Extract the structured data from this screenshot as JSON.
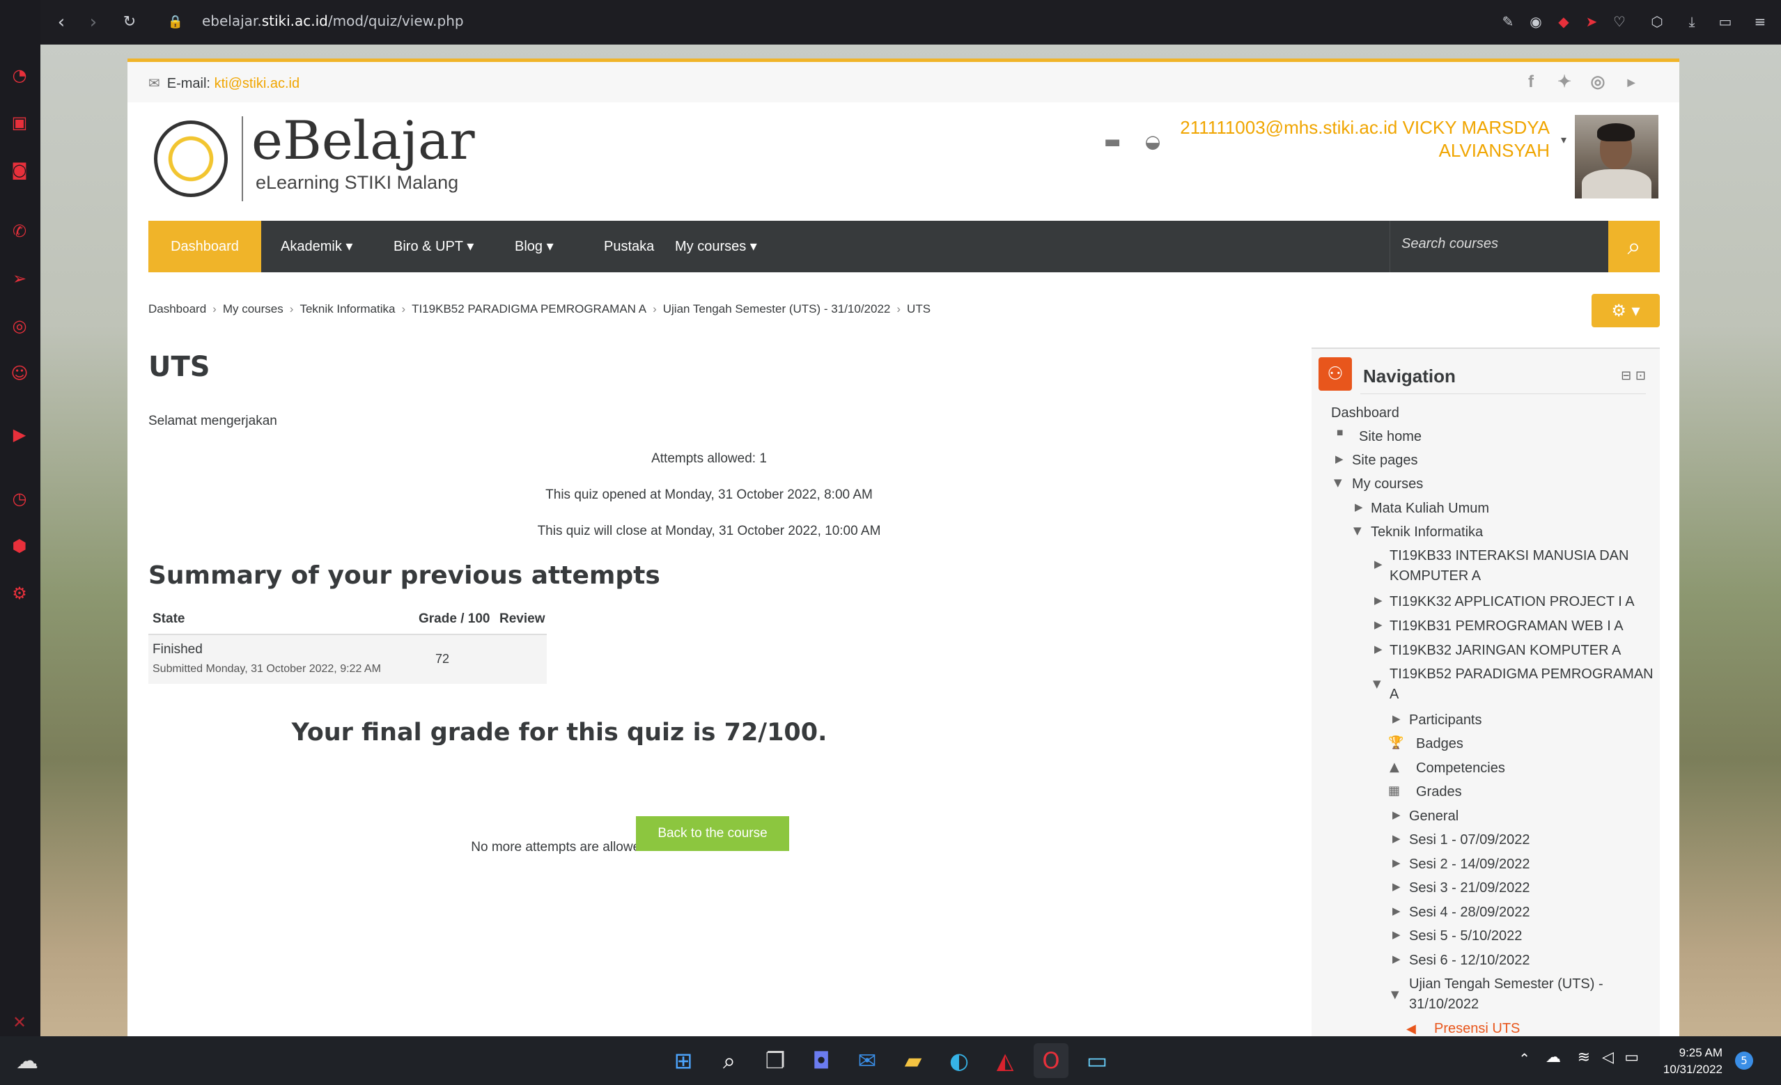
{
  "browser": {
    "url_prefix": "ebelajar.",
    "url_domain": "stiki.ac.id",
    "url_path": "/mod/quiz/view.php"
  },
  "topbar": {
    "email_label": "E-mail:",
    "email_value": "kti@stiki.ac.id"
  },
  "header": {
    "logo_title": "eBelajar",
    "logo_subtitle": "eLearning STIKI Malang",
    "user_name": "211111003@mhs.stiki.ac.id VICKY MARSDYA ALVIANSYAH"
  },
  "mainnav": {
    "items": [
      {
        "label": "Dashboard"
      },
      {
        "label": "Akademik ▾"
      },
      {
        "label": "Biro & UPT ▾"
      },
      {
        "label": "Blog ▾"
      },
      {
        "label": "Pustaka"
      },
      {
        "label": "My courses ▾"
      }
    ],
    "search_placeholder": "Search courses"
  },
  "breadcrumb": [
    "Dashboard",
    "My courses",
    "Teknik Informatika",
    "TI19KB52 PARADIGMA PEMROGRAMAN A",
    "Ujian Tengah Semester (UTS) - 31/10/2022",
    "UTS"
  ],
  "main": {
    "title": "UTS",
    "intro": "Selamat mengerjakan",
    "attempts_allowed": "Attempts allowed: 1",
    "opened": "This quiz opened at Monday, 31 October 2022, 8:00 AM",
    "closes": "This quiz will close at Monday, 31 October 2022, 10:00 AM",
    "summary_title": "Summary of your previous attempts",
    "table": {
      "headers": [
        "State",
        "Grade / 100",
        "Review"
      ],
      "row_state": "Finished",
      "row_submitted": "Submitted Monday, 31 October 2022, 9:22 AM",
      "row_grade": "72"
    },
    "final_grade": "Your final grade for this quiz is 72/100.",
    "no_more": "No more attempts are allowed",
    "back_button": "Back to the course"
  },
  "navigation": {
    "title": "Navigation",
    "dashboard": "Dashboard",
    "site_home": "Site home",
    "site_pages": "Site pages",
    "my_courses": "My courses",
    "mku": "Mata Kuliah Umum",
    "ti": "Teknik Informatika",
    "c1a": "TI19KB33 INTERAKSI MANUSIA DAN",
    "c1b": "KOMPUTER A",
    "c2": "TI19KK32 APPLICATION PROJECT I A",
    "c3": "TI19KB31 PEMROGRAMAN WEB I A",
    "c4": "TI19KB32 JARINGAN KOMPUTER A",
    "c5a": "TI19KB52 PARADIGMA PEMROGRAMAN",
    "c5b": "A",
    "participants": "Participants",
    "badges": "Badges",
    "competencies": "Competencies",
    "grades": "Grades",
    "general": "General",
    "sesi": [
      "Sesi 1 - 07/09/2022",
      "Sesi 2 - 14/09/2022",
      "Sesi 3 - 21/09/2022",
      "Sesi 4 - 28/09/2022",
      "Sesi 5 - 5/10/2022",
      "Sesi 6 - 12/10/2022"
    ],
    "uts_a": "Ujian Tengah Semester (UTS) -",
    "uts_b": "31/10/2022",
    "presensi": "Presensi UTS"
  },
  "taskbar": {
    "time": "9:25 AM",
    "date": "10/31/2022",
    "notifications": "5"
  },
  "colors": {
    "accent": "#f0b429",
    "nav_dark": "#373a3c",
    "button_green": "#8cc63f",
    "nav_icon": "#e8561c",
    "browser_red": "#e8303b"
  }
}
